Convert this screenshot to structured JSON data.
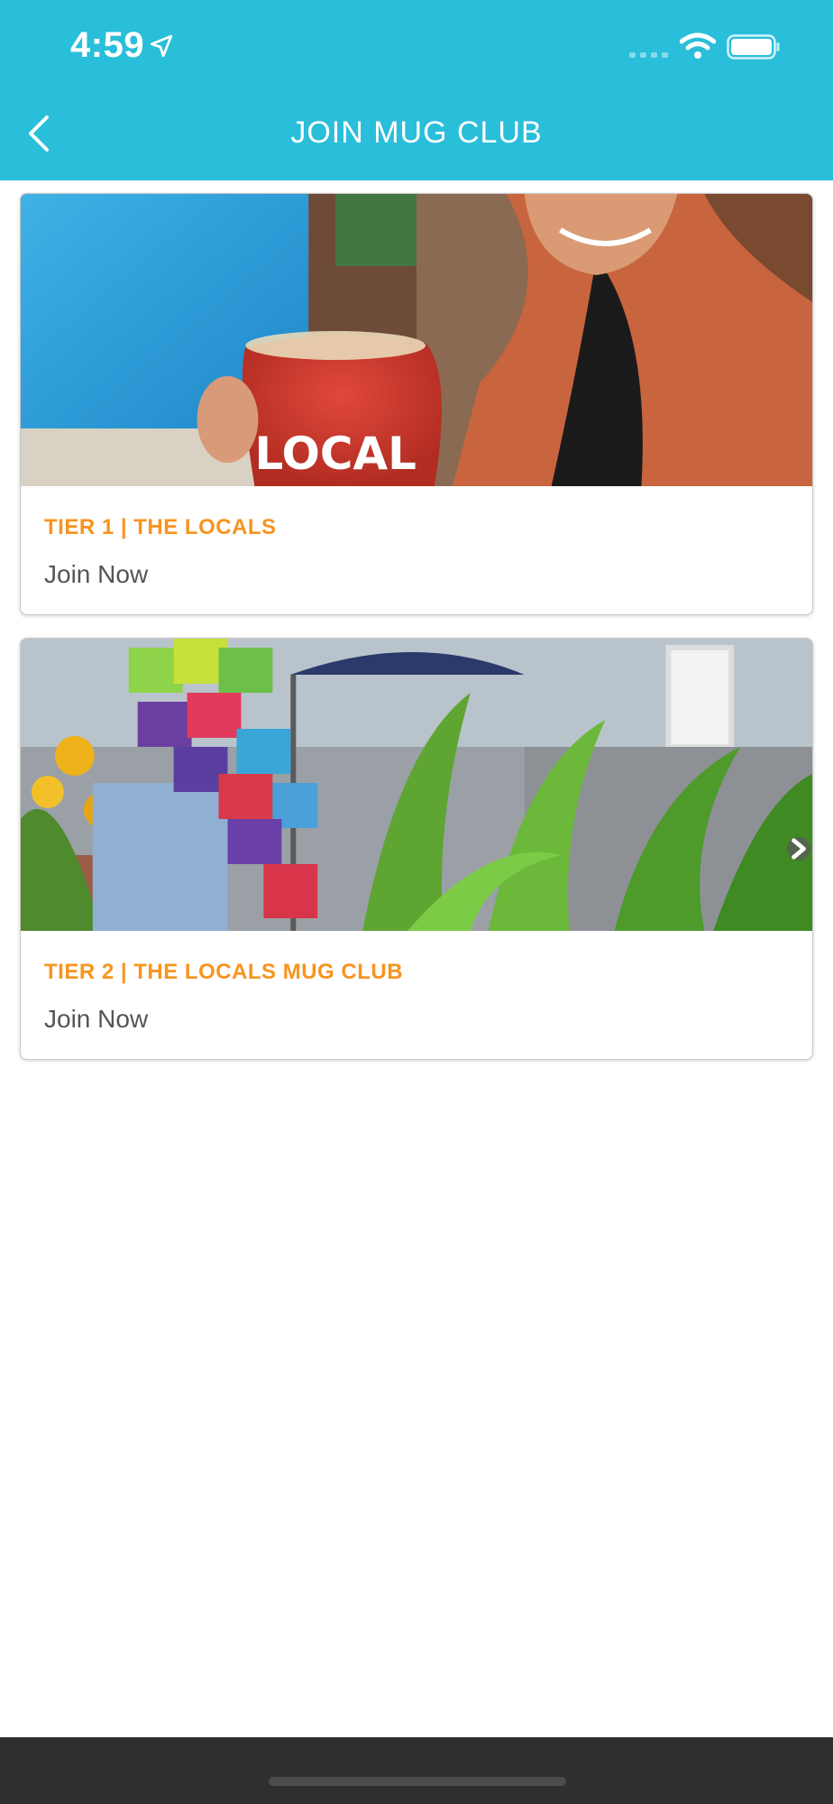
{
  "status_bar": {
    "time": "4:59",
    "icons": [
      "location-arrow-icon",
      "cellular-signal-icon",
      "wifi-icon",
      "battery-icon"
    ]
  },
  "nav": {
    "title": "JOIN MUG CLUB",
    "back_icon": "chevron-left-icon"
  },
  "cards": [
    {
      "image_text": "LOCAL",
      "title": "TIER 1 | THE LOCALS",
      "cta": "Join Now"
    },
    {
      "title": "TIER 2 | THE LOCALS MUG CLUB",
      "cta": "Join Now"
    }
  ],
  "colors": {
    "header": "#29bed9",
    "accent": "#f7941e",
    "cta_text": "#555555",
    "home_bar": "#2f2f2f"
  }
}
